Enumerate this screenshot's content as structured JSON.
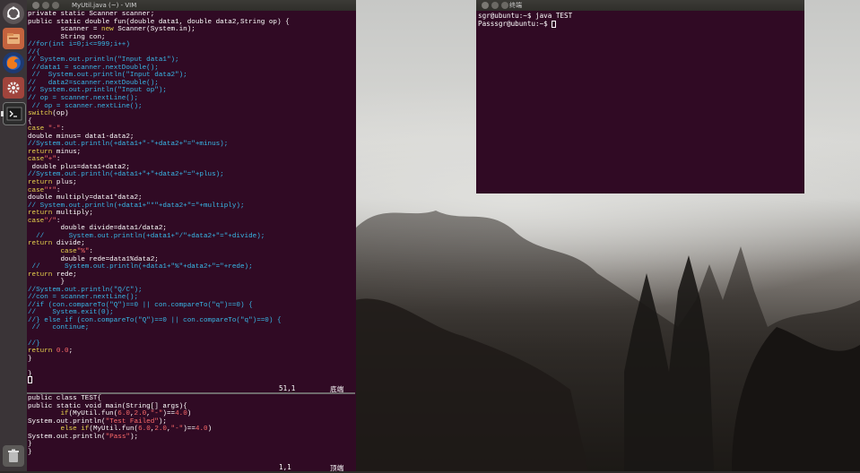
{
  "vim_window": {
    "title": "MyUtil.java (~) - VIM",
    "top_pane": {
      "lines": [
        [
          {
            "t": "private static Scanner scanner;",
            "c": ""
          }
        ],
        [
          {
            "t": "public static double fun(double data1, double data2,String op) {",
            "c": ""
          }
        ],
        [
          {
            "t": "        scanner = ",
            "c": ""
          },
          {
            "t": "new",
            "c": "k"
          },
          {
            "t": " Scanner(System.in);",
            "c": ""
          }
        ],
        [
          {
            "t": "        String con;",
            "c": ""
          }
        ],
        [
          {
            "t": "//for(int i=0;i<=999;i++)",
            "c": "c"
          }
        ],
        [
          {
            "t": "//{",
            "c": "c"
          }
        ],
        [
          {
            "t": "// System.out.println(\"Input data1\");",
            "c": "c"
          }
        ],
        [
          {
            "t": " //data1 = scanner.nextDouble();",
            "c": "c"
          }
        ],
        [
          {
            "t": " //  System.out.println(\"Input data2\");",
            "c": "c"
          }
        ],
        [
          {
            "t": "//   data2=scanner.nextDouble();",
            "c": "c"
          }
        ],
        [
          {
            "t": "// System.out.println(\"Input op\");",
            "c": "c"
          }
        ],
        [
          {
            "t": "// op = scanner.nextLine();",
            "c": "c"
          }
        ],
        [
          {
            "t": " // op = scanner.nextLine();",
            "c": "c"
          }
        ],
        [
          {
            "t": "switch",
            "c": "k"
          },
          {
            "t": "(op)",
            "c": ""
          }
        ],
        [
          {
            "t": "{",
            "c": ""
          }
        ],
        [
          {
            "t": "case",
            "c": "k"
          },
          {
            "t": " ",
            "c": ""
          },
          {
            "t": "\"-\"",
            "c": "s"
          },
          {
            "t": ":",
            "c": ""
          }
        ],
        [
          {
            "t": "double minus= data1-data2;",
            "c": ""
          }
        ],
        [
          {
            "t": "//System.out.println(+data1+\"-\"+data2+\"=\"+minus);",
            "c": "c"
          }
        ],
        [
          {
            "t": "return",
            "c": "k"
          },
          {
            "t": " minus;",
            "c": ""
          }
        ],
        [
          {
            "t": "case",
            "c": "k"
          },
          {
            "t": "\"+\"",
            "c": "s"
          },
          {
            "t": ":",
            "c": ""
          }
        ],
        [
          {
            "t": " double plus=data1+data2;",
            "c": ""
          }
        ],
        [
          {
            "t": "//System.out.println(+data1+\"+\"+data2+\"=\"+plus);",
            "c": "c"
          }
        ],
        [
          {
            "t": "return",
            "c": "k"
          },
          {
            "t": " plus;",
            "c": ""
          }
        ],
        [
          {
            "t": "case",
            "c": "k"
          },
          {
            "t": "\"*\"",
            "c": "s"
          },
          {
            "t": ":",
            "c": ""
          }
        ],
        [
          {
            "t": "double multiply=data1*data2;",
            "c": ""
          }
        ],
        [
          {
            "t": "// System.out.println(+data1+\"*\"+data2+\"=\"+multiply);",
            "c": "c"
          }
        ],
        [
          {
            "t": "return",
            "c": "k"
          },
          {
            "t": " multiply;",
            "c": ""
          }
        ],
        [
          {
            "t": "case",
            "c": "k"
          },
          {
            "t": "\"/\"",
            "c": "s"
          },
          {
            "t": ":",
            "c": ""
          }
        ],
        [
          {
            "t": "        double divide=data1/data2;",
            "c": ""
          }
        ],
        [
          {
            "t": "  //      System.out.println(+data1+\"/\"+data2+\"=\"+divide);",
            "c": "c"
          }
        ],
        [
          {
            "t": "return",
            "c": "k"
          },
          {
            "t": " divide;",
            "c": ""
          }
        ],
        [
          {
            "t": "        ",
            "c": ""
          },
          {
            "t": "case",
            "c": "k"
          },
          {
            "t": "\"%\"",
            "c": "s"
          },
          {
            "t": ":",
            "c": ""
          }
        ],
        [
          {
            "t": "        double rede=data1%data2;",
            "c": ""
          }
        ],
        [
          {
            "t": " //      System.out.println(+data1+\"%\"+data2+\"=\"+rede);",
            "c": "c"
          }
        ],
        [
          {
            "t": "return",
            "c": "k"
          },
          {
            "t": " rede;",
            "c": ""
          }
        ],
        [
          {
            "t": "        }",
            "c": ""
          }
        ],
        [
          {
            "t": "//System.out.println(\"Q/C\");",
            "c": "c"
          }
        ],
        [
          {
            "t": "//con = scanner.nextLine();",
            "c": "c"
          }
        ],
        [
          {
            "t": "//if (con.compareTo(\"Q\")==0 || con.compareTo(\"q\")==0) {",
            "c": "c"
          }
        ],
        [
          {
            "t": "//    System.exit(0);",
            "c": "c"
          }
        ],
        [
          {
            "t": "//} else if (con.compareTo(\"Q\")==0 || con.compareTo(\"q\")==0) {",
            "c": "c"
          }
        ],
        [
          {
            "t": " //   continue;",
            "c": "c"
          }
        ],
        [
          {
            "t": "",
            "c": ""
          }
        ],
        [
          {
            "t": "//}",
            "c": "c"
          }
        ],
        [
          {
            "t": "return",
            "c": "k"
          },
          {
            "t": " ",
            "c": ""
          },
          {
            "t": "0.0",
            "c": "n"
          },
          {
            "t": ";",
            "c": ""
          }
        ],
        [
          {
            "t": "}",
            "c": ""
          }
        ],
        [
          {
            "t": "",
            "c": ""
          }
        ],
        [
          {
            "t": "}",
            "c": ""
          }
        ]
      ],
      "position": "51,1",
      "scroll": "底端"
    },
    "bottom_pane": {
      "lines": [
        [
          {
            "t": "public class TEST{",
            "c": ""
          }
        ],
        [
          {
            "t": "public static void main(String[] args){",
            "c": ""
          }
        ],
        [
          {
            "t": "        ",
            "c": ""
          },
          {
            "t": "if",
            "c": "k"
          },
          {
            "t": "(MyUtil.fun(",
            "c": ""
          },
          {
            "t": "6.0",
            "c": "n"
          },
          {
            "t": ",",
            "c": ""
          },
          {
            "t": "2.0",
            "c": "n"
          },
          {
            "t": ",",
            "c": ""
          },
          {
            "t": "\"-\"",
            "c": "s"
          },
          {
            "t": ")==",
            "c": ""
          },
          {
            "t": "4.0",
            "c": "n"
          },
          {
            "t": ")",
            "c": ""
          }
        ],
        [
          {
            "t": "System.out.println(",
            "c": ""
          },
          {
            "t": "\"Test Failed\"",
            "c": "s"
          },
          {
            "t": ");",
            "c": ""
          }
        ],
        [
          {
            "t": "        ",
            "c": ""
          },
          {
            "t": "else",
            "c": "k"
          },
          {
            "t": " ",
            "c": ""
          },
          {
            "t": "if",
            "c": "k"
          },
          {
            "t": "(MyUtil.fun(",
            "c": ""
          },
          {
            "t": "6.0",
            "c": "n"
          },
          {
            "t": ",",
            "c": ""
          },
          {
            "t": "2.0",
            "c": "n"
          },
          {
            "t": ",",
            "c": ""
          },
          {
            "t": "\"-\"",
            "c": "s"
          },
          {
            "t": ")==",
            "c": ""
          },
          {
            "t": "4.0",
            "c": "n"
          },
          {
            "t": ")",
            "c": ""
          }
        ],
        [
          {
            "t": "System.out.println(",
            "c": ""
          },
          {
            "t": "\"Pass\"",
            "c": "s"
          },
          {
            "t": ");",
            "c": ""
          }
        ],
        [
          {
            "t": "}",
            "c": ""
          }
        ],
        [
          {
            "t": "}",
            "c": ""
          }
        ]
      ],
      "position": "1,1",
      "scroll": "顶端"
    }
  },
  "terminal_window": {
    "title": "终端",
    "lines": [
      "sgr@ubuntu:~$ java TEST",
      "Passsgr@ubuntu:~$ "
    ]
  },
  "launcher": {
    "items": [
      {
        "name": "dash-home-icon"
      },
      {
        "name": "files-icon"
      },
      {
        "name": "firefox-icon"
      },
      {
        "name": "system-settings-icon"
      },
      {
        "name": "terminal-icon"
      },
      {
        "name": "trash-icon"
      }
    ]
  },
  "colors": {
    "terminal_bg": "#300a24",
    "keyword": "#e8d44d",
    "string": "#ff6b6b",
    "comment": "#38b8e8"
  }
}
